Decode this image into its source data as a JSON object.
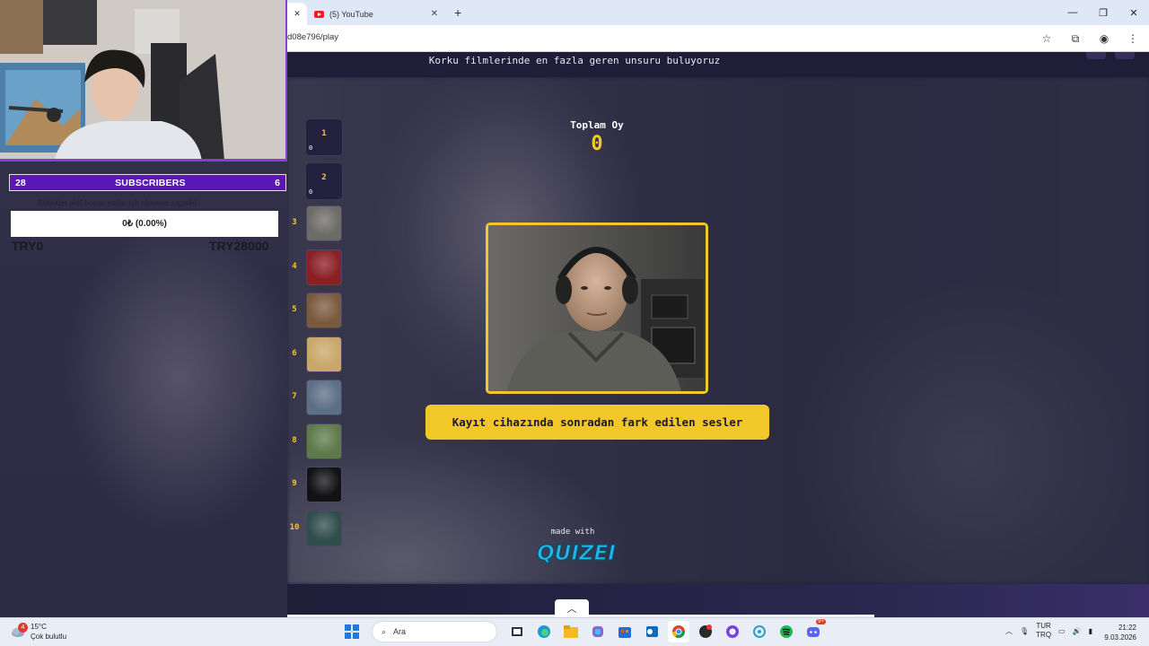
{
  "browser": {
    "tabs": [
      {
        "label": "(5) YouTube"
      }
    ],
    "url": "d08e796/play",
    "window_controls": [
      "minimize",
      "restore",
      "close"
    ]
  },
  "quiz": {
    "title": "Korku filmlerinde en fazla geren unsuru buluyoruz",
    "total_votes_label": "Toplam Oy",
    "total_votes_value": "0",
    "current_card_label": "Kayıt cihazında sonradan fark edilen sesler",
    "made_with_label": "made with",
    "logo_text": "QUIZEI",
    "ranks": [
      {
        "number": "1",
        "votes": "0",
        "filled": false
      },
      {
        "number": "2",
        "votes": "0",
        "filled": false
      },
      {
        "number": "3",
        "filled": true,
        "thumb_color": "#6d6b66"
      },
      {
        "number": "4",
        "filled": true,
        "thumb_color": "#8a1f24"
      },
      {
        "number": "5",
        "filled": true,
        "thumb_color": "#7a5a3e"
      },
      {
        "number": "6",
        "filled": true,
        "thumb_color": "#c9a76a"
      },
      {
        "number": "7",
        "filled": true,
        "thumb_color": "#5d6f86"
      },
      {
        "number": "8",
        "filled": true,
        "thumb_color": "#5e7a4b"
      },
      {
        "number": "9",
        "filled": true,
        "thumb_color": "#121214"
      },
      {
        "number": "10",
        "filled": true,
        "thumb_color": "#2f4d4a"
      }
    ]
  },
  "overlay": {
    "subs_left": "28",
    "subs_label": "SUBSCRIBERS",
    "subs_right": "6",
    "ghost_text": "Taksitler akıl bozan yatlar tak olmasaz sagadel",
    "progress_text": "0₺ (0.00%)",
    "progress_fraction": 0,
    "goal_min": "TRY0",
    "goal_max": "TRY28000",
    "accent_color": "#5a17b5"
  },
  "taskbar": {
    "weather_temp": "15°C",
    "weather_desc": "Çok bulutlu",
    "weather_badge": "4",
    "search_placeholder": "Ara",
    "lang_top": "TUR",
    "lang_bottom": "TRQ",
    "time": "21:22",
    "date": "9.03.2026",
    "discord_badge": "9+"
  }
}
